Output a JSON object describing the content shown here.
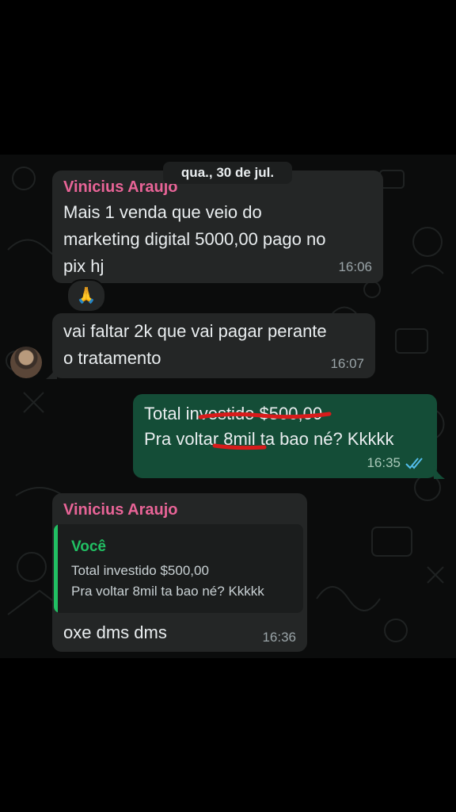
{
  "date_chip": "qua., 30 de jul.",
  "messages": [
    {
      "sender": "Vinicius Araujo",
      "lines": [
        "Mais 1 venda que veio do",
        "marketing digital 5000,00 pago no",
        "pix hj"
      ],
      "time": "16:06",
      "reaction": "🙏"
    },
    {
      "lines": [
        "vai faltar 2k que vai pagar perante",
        "o tratamento"
      ],
      "time": "16:07"
    },
    {
      "lines": [
        "Total investido $500,00",
        "Pra voltar 8mil ta bao né? Kkkkk"
      ],
      "time": "16:35",
      "status": "read",
      "status_icon": "double-check-icon"
    },
    {
      "sender": "Vinicius Araujo",
      "quote": {
        "author": "Você",
        "lines": [
          "Total investido $500,00",
          "Pra voltar 8mil ta bao né? Kkkkk"
        ]
      },
      "lines": [
        "oxe dms dms"
      ],
      "time": "16:36"
    }
  ],
  "colors": {
    "incoming_bubble": "#242626",
    "outgoing_bubble": "#144d37",
    "sender_name": "#e86497",
    "quote_accent": "#21c063",
    "read_ticks": "#53bdeb",
    "annotation_underline": "#d81b1b"
  }
}
